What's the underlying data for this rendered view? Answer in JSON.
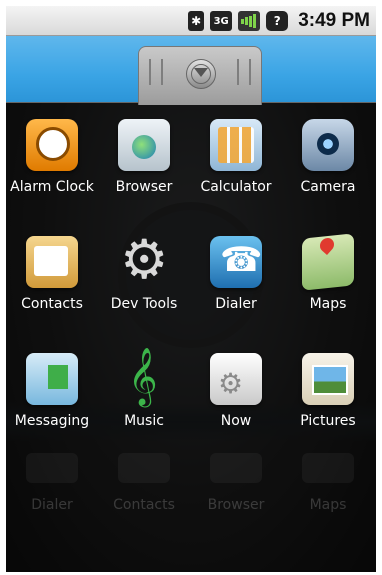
{
  "statusbar": {
    "time": "3:49 PM",
    "network_label": "3G",
    "battery_label": "?",
    "icons": [
      "bluetooth-icon",
      "3g-data-icon",
      "signal-strength-icon",
      "battery-icon"
    ]
  },
  "drawer": {
    "apps": [
      {
        "label": "Alarm Clock",
        "icon": "alarm-clock-icon"
      },
      {
        "label": "Browser",
        "icon": "browser-icon"
      },
      {
        "label": "Calculator",
        "icon": "calculator-icon"
      },
      {
        "label": "Camera",
        "icon": "camera-icon"
      },
      {
        "label": "Contacts",
        "icon": "contacts-icon"
      },
      {
        "label": "Dev Tools",
        "icon": "dev-tools-icon"
      },
      {
        "label": "Dialer",
        "icon": "dialer-icon"
      },
      {
        "label": "Maps",
        "icon": "maps-icon"
      },
      {
        "label": "Messaging",
        "icon": "messaging-icon"
      },
      {
        "label": "Music",
        "icon": "music-icon"
      },
      {
        "label": "Now",
        "icon": "now-icon"
      },
      {
        "label": "Pictures",
        "icon": "pictures-icon"
      }
    ],
    "reflection_labels": [
      "Dialer",
      "Contacts",
      "Browser",
      "Maps"
    ]
  },
  "colors": {
    "statusbar_bg": "#e6e6e6",
    "sky": "#3aa4e5",
    "label_text": "#ffffff"
  }
}
